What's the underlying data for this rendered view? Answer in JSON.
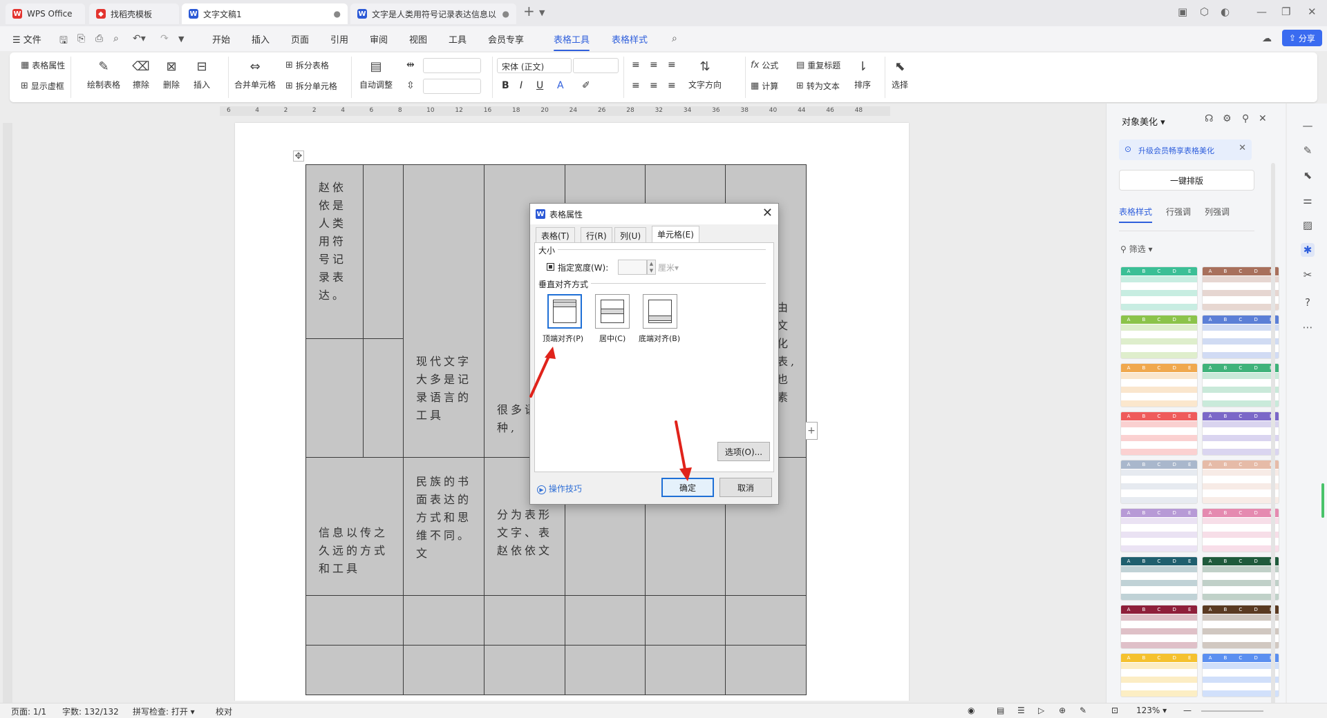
{
  "tabs": [
    {
      "label": "WPS Office",
      "icon": "wps-logo-icon"
    },
    {
      "label": "找稻壳模板",
      "icon": "docer-icon"
    },
    {
      "label": "文字文稿1",
      "icon": "word-doc-icon"
    },
    {
      "label": "文字是人类用符号记录表达信息以",
      "icon": "word-doc-icon"
    }
  ],
  "menu": {
    "file": "文件",
    "items": [
      "开始",
      "插入",
      "页面",
      "引用",
      "审阅",
      "视图",
      "工具",
      "会员专享"
    ],
    "context_items": [
      "表格工具",
      "表格样式"
    ],
    "share": "分享"
  },
  "ribbon": {
    "table_props": "表格属性",
    "show_gridlines": "显示虚框",
    "draw_table": "绘制表格",
    "erase": "擦除",
    "delete": "删除",
    "insert": "插入",
    "merge_cells": "合并单元格",
    "split_table": "拆分表格",
    "split_cells": "拆分单元格",
    "auto_fit": "自动调整",
    "font_name": "宋体 (正文)",
    "font_size": "",
    "text_direction": "文字方向",
    "formula": "公式",
    "calculate": "计算",
    "repeat_header": "重复标题",
    "convert_text": "转为文本",
    "sort": "排序",
    "select": "选择"
  },
  "ruler": {
    "h_ticks": [
      "6",
      "4",
      "2",
      "2",
      "4",
      "6",
      "8",
      "10",
      "12",
      "16",
      "18",
      "20",
      "24",
      "26",
      "28",
      "32",
      "34",
      "36",
      "38",
      "40",
      "44",
      "46",
      "48"
    ]
  },
  "document": {
    "cells": {
      "r1c1": "赵依依是人类用符号记录表达。",
      "r2c3": "现代文字大多是记录语言的工具",
      "r2c4": "很多语种,",
      "r2c7": "由文化表,也素",
      "r3c1": "信息以传之久远的方式和工具",
      "r3c3": "民族的书面表达的方式和思维不同。文",
      "r3c4": "分为表形文字、表赵依依文"
    }
  },
  "dialog": {
    "title": "表格属性",
    "tabs": [
      "表格(T)",
      "行(R)",
      "列(U)",
      "单元格(E)"
    ],
    "size_group": "大小",
    "specify_width": "指定宽度(W):",
    "width_value": "",
    "unit": "厘米",
    "valign_group": "垂直对齐方式",
    "valign_options": [
      "顶端对齐(P)",
      "居中(C)",
      "底端对齐(B)"
    ],
    "options_button": "选项(O)...",
    "tips_link": "操作技巧",
    "ok": "确定",
    "cancel": "取消"
  },
  "right_panel": {
    "title": "对象美化",
    "promo": "升级会员畅享表格美化",
    "one_click": "一键排版",
    "tabs": [
      "表格样式",
      "行强调",
      "列强调"
    ],
    "filter": "筛选",
    "thumb_head": "A B C D E",
    "theme_colors": [
      "#3bbf96",
      "#a8705c",
      "#8bc34a",
      "#5b7fd6",
      "#f0a84e",
      "#3fb27a",
      "#ef5b5b",
      "#7b68c8",
      "#a9b7cc",
      "#e6bba8",
      "#b79ad6",
      "#e58ab0",
      "#1f5f6e",
      "#1f5a3c",
      "#8e1f3a",
      "#5a3a22",
      "#f5c12e",
      "#5b8ff0"
    ]
  },
  "status": {
    "page": "页面: 1/1",
    "words": "字数: 132/132",
    "spell": "拼写检查: 打开",
    "proof": "校对",
    "zoom": "123%"
  },
  "colors": {
    "accent": "#2f5fdc",
    "arrow": "#e0231b",
    "table_fill": "#c6c6c6"
  }
}
